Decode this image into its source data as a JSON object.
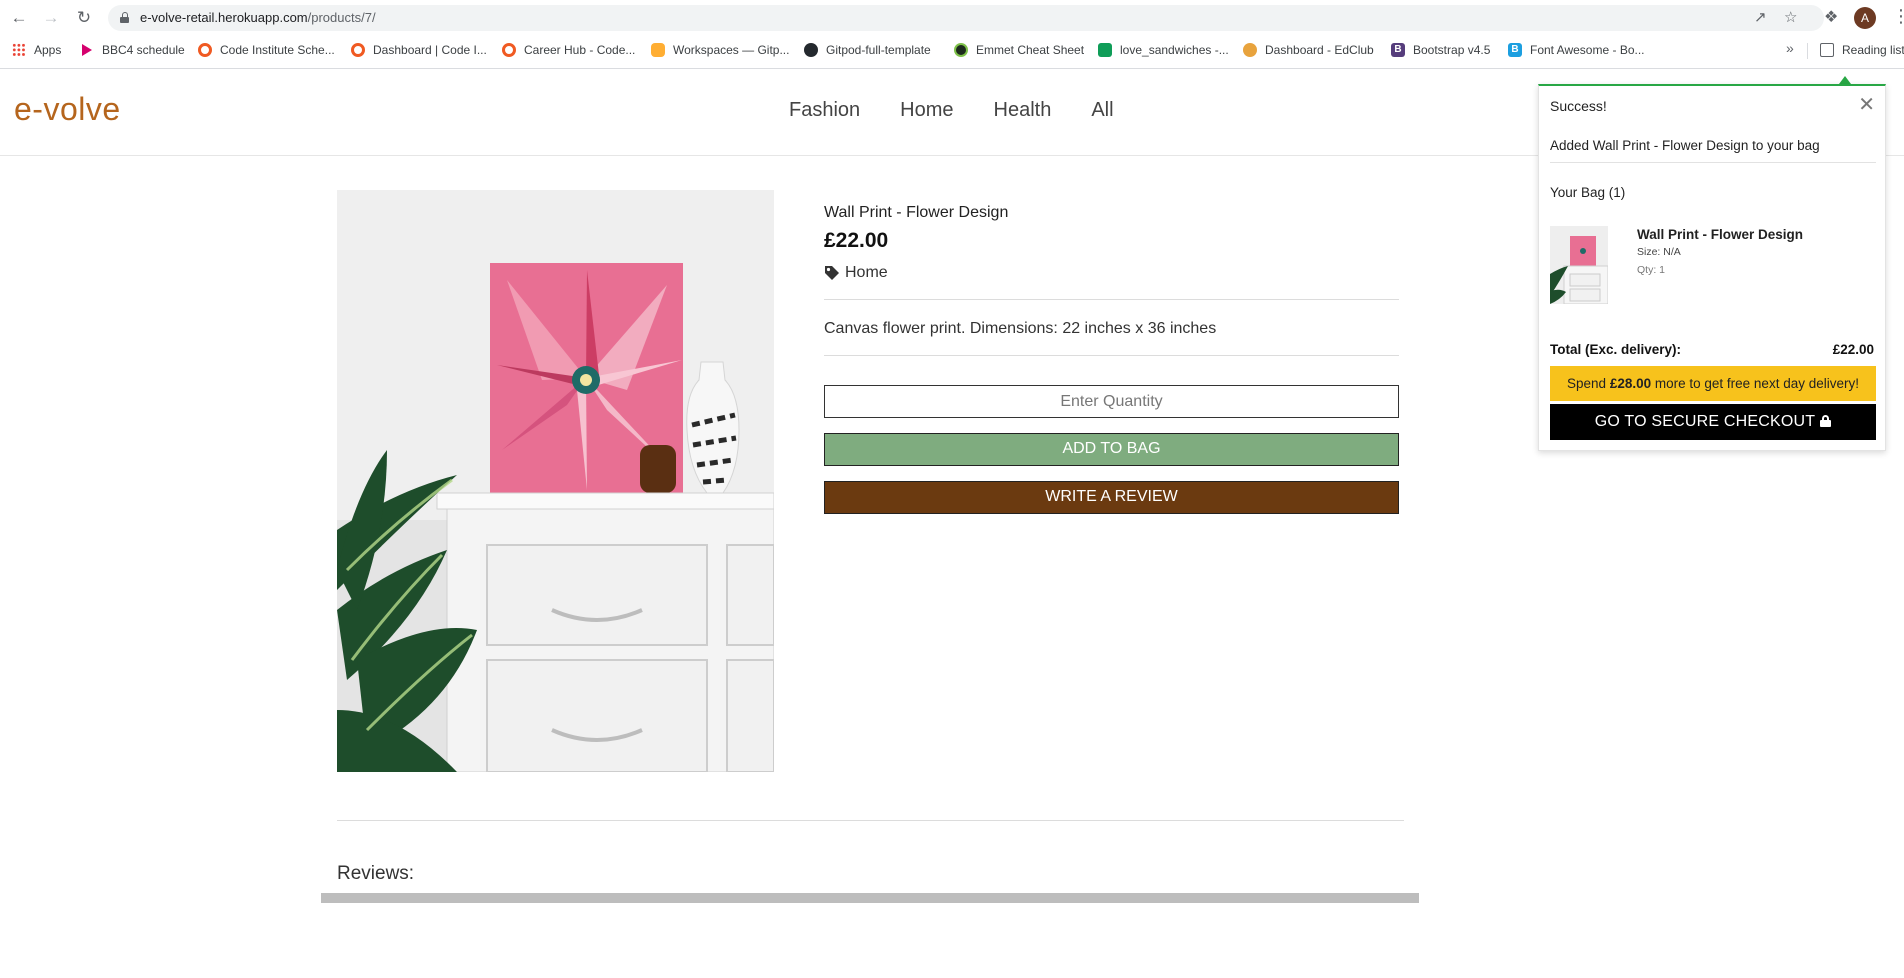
{
  "browser": {
    "url_host": "e-volve-retail.herokuapp.com",
    "url_path": "/products/7/",
    "profile_initial": "A",
    "bookmarks": [
      {
        "label": "Apps",
        "icon": "apps-grid-icon"
      },
      {
        "label": "BBC4 schedule",
        "icon": "bbc-play-icon"
      },
      {
        "label": "Code Institute Sche...",
        "icon": "code-institute-icon"
      },
      {
        "label": "Dashboard | Code I...",
        "icon": "code-institute-icon"
      },
      {
        "label": "Career Hub - Code...",
        "icon": "code-institute-icon"
      },
      {
        "label": "Workspaces — Gitp...",
        "icon": "gitpod-icon"
      },
      {
        "label": "Gitpod-full-template",
        "icon": "github-icon"
      },
      {
        "label": "Emmet Cheat Sheet",
        "icon": "emmet-icon"
      },
      {
        "label": "love_sandwiches -...",
        "icon": "sheets-icon"
      },
      {
        "label": "Dashboard - EdClub",
        "icon": "edclub-icon"
      },
      {
        "label": "Bootstrap v4.5",
        "icon": "bootstrap-icon"
      },
      {
        "label": "Font Awesome - Bo...",
        "icon": "font-awesome-icon"
      }
    ],
    "reading_list": "Reading list"
  },
  "site": {
    "logo": "e-volve",
    "nav": [
      "Fashion",
      "Home",
      "Health",
      "All"
    ]
  },
  "product": {
    "name": "Wall Print - Flower Design",
    "price": "£22.00",
    "category": "Home",
    "description": "Canvas flower print. Dimensions: 22 inches x 36 inches",
    "quantity_placeholder": "Enter Quantity",
    "add_to_bag": "ADD TO BAG",
    "write_review": "WRITE A REVIEW"
  },
  "reviews": {
    "title": "Reviews:"
  },
  "toast": {
    "title": "Success!",
    "message": "Added Wall Print - Flower Design to your bag",
    "bag_count": "Your Bag (1)",
    "item_name": "Wall Print - Flower Design",
    "item_size": "Size: N/A",
    "item_qty": "Qty: 1",
    "total_label": "Total (Exc. delivery):",
    "total_value": "£22.00",
    "delivery_prefix": "Spend",
    "delivery_amount": "£28.00",
    "delivery_suffix": "more to get free next day delivery!",
    "checkout": "GO TO SECURE CHECKOUT"
  },
  "colors": {
    "brand": "#b5651d",
    "add_to_bag": "#7fac7f",
    "write_review": "#6b3a10",
    "success": "#28a745",
    "delivery_banner": "#f7c21c"
  }
}
